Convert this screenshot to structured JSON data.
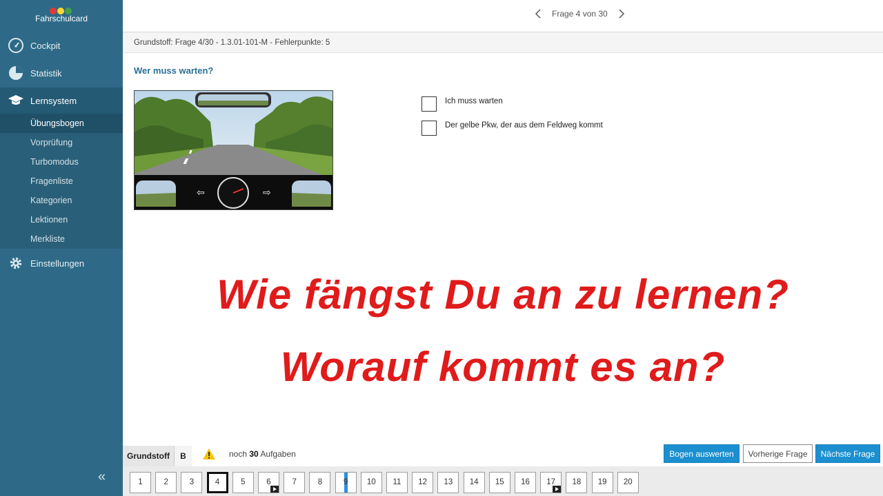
{
  "brand": {
    "name": "Fahrschulcard",
    "light_colors": [
      "#e53935",
      "#fdd835",
      "#43a047"
    ]
  },
  "sidebar": {
    "main_items": [
      {
        "label": "Cockpit",
        "icon": "gauge-icon"
      },
      {
        "label": "Statistik",
        "icon": "pie-chart-icon"
      },
      {
        "label": "Lernsystem",
        "icon": "graduation-cap-icon"
      },
      {
        "label": "Einstellungen",
        "icon": "gear-icon"
      }
    ],
    "sub_items": [
      "Übungsbogen",
      "Vorprüfung",
      "Turbomodus",
      "Fragenliste",
      "Kategorien",
      "Lektionen",
      "Merkliste"
    ],
    "active_sub": "Übungsbogen",
    "collapse_icon": "double-chevron-left-icon"
  },
  "topbar": {
    "pager_label": "Frage 4 von 30"
  },
  "infobar": {
    "text": "Grundstoff: Frage 4/30 - 1.3.01-101-M - Fehlerpunkte: 5"
  },
  "question": {
    "title": "Wer muss warten?",
    "answers": [
      "Ich muss warten",
      "Der gelbe Pkw, der aus dem Feldweg kommt"
    ]
  },
  "overlay": {
    "line1": "Wie fängst Du an zu lernen?",
    "line2": "Worauf kommt es an?",
    "color": "#e01b1b"
  },
  "bottom": {
    "tab_grundstoff": "Grundstoff",
    "tab_b": "B",
    "remaining_prefix": "noch",
    "remaining_count": "30",
    "remaining_suffix": "Aufgaben",
    "btn_evaluate": "Bogen auswerten",
    "btn_prev": "Vorherige Frage",
    "btn_next": "Nächste Frage"
  },
  "numbers": {
    "items": [
      "1",
      "2",
      "3",
      "4",
      "5",
      "6",
      "7",
      "8",
      "9",
      "10",
      "11",
      "12",
      "13",
      "14",
      "15",
      "16",
      "17",
      "18",
      "19",
      "20"
    ],
    "current": "4",
    "video_items": [
      "6",
      "17"
    ],
    "marked_items": [
      "9"
    ]
  }
}
